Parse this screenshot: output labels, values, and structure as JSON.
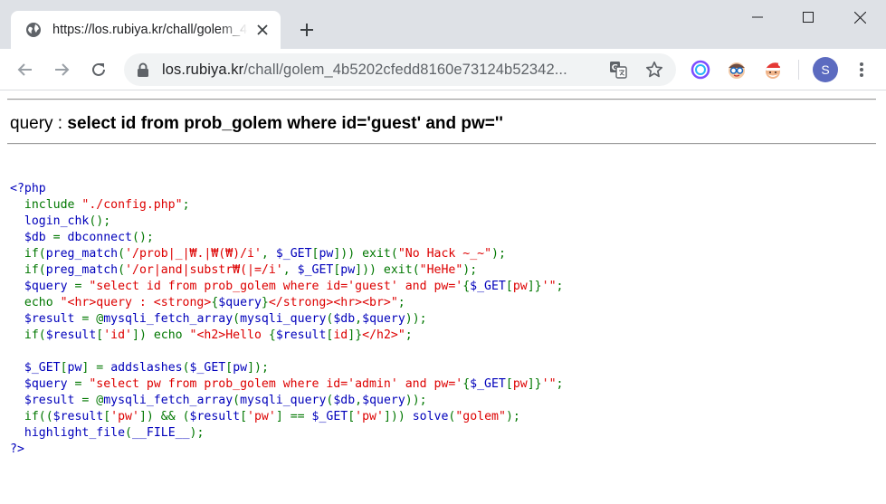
{
  "browser": {
    "tab": {
      "title": "https://los.rubiya.kr/chall/golem_4b5202cfedd8160e73124b52342..."
    },
    "address_bar": {
      "host": "los.rubiya.kr",
      "path": "/chall/golem_4b5202cfedd8160e73124b52342..."
    },
    "profile_initial": "S",
    "icons": {
      "tab_favicon": "globe-icon",
      "tab_close": "close-icon",
      "new_tab": "plus-icon",
      "minimize": "minimize-icon",
      "maximize": "maximize-icon",
      "close_window": "close-icon",
      "back": "arrow-left-icon",
      "forward": "arrow-right-icon",
      "reload": "reload-icon",
      "secure": "lock-icon",
      "translate": "translate-icon",
      "bookmark": "star-icon",
      "extensions": [
        "ring-extension-icon",
        "glasses-face-extension-icon",
        "santa-extension-icon"
      ],
      "menu": "three-dots-icon"
    },
    "colors": {
      "tabstrip": "#dee1e6",
      "omnibox": "#f1f3f4",
      "avatar": "#5c6bc0"
    }
  },
  "page": {
    "query_label": "query : ",
    "query_value": "select id from prob_golem where id='guest' and pw=''",
    "code_lines": [
      [
        {
          "t": "<?php",
          "c": "def"
        }
      ],
      [
        {
          "t": "  include ",
          "c": "kw"
        },
        {
          "t": "\"./config.php\"",
          "c": "str"
        },
        {
          "t": ";",
          "c": "kw"
        }
      ],
      [
        {
          "t": "  login_chk",
          "c": "def"
        },
        {
          "t": "();",
          "c": "kw"
        }
      ],
      [
        {
          "t": "  $db ",
          "c": "def"
        },
        {
          "t": "= ",
          "c": "kw"
        },
        {
          "t": "dbconnect",
          "c": "def"
        },
        {
          "t": "();",
          "c": "kw"
        }
      ],
      [
        {
          "t": "  if(",
          "c": "kw"
        },
        {
          "t": "preg_match",
          "c": "def"
        },
        {
          "t": "(",
          "c": "kw"
        },
        {
          "t": "'/prob|_|₩.|₩(₩)/i'",
          "c": "str"
        },
        {
          "t": ", ",
          "c": "kw"
        },
        {
          "t": "$_GET",
          "c": "def"
        },
        {
          "t": "[",
          "c": "kw"
        },
        {
          "t": "pw",
          "c": "def"
        },
        {
          "t": "])) exit(",
          "c": "kw"
        },
        {
          "t": "\"No Hack ~_~\"",
          "c": "str"
        },
        {
          "t": ");",
          "c": "kw"
        }
      ],
      [
        {
          "t": "  if(",
          "c": "kw"
        },
        {
          "t": "preg_match",
          "c": "def"
        },
        {
          "t": "(",
          "c": "kw"
        },
        {
          "t": "'/or|and|substr₩(|=/i'",
          "c": "str"
        },
        {
          "t": ", ",
          "c": "kw"
        },
        {
          "t": "$_GET",
          "c": "def"
        },
        {
          "t": "[",
          "c": "kw"
        },
        {
          "t": "pw",
          "c": "def"
        },
        {
          "t": "])) exit(",
          "c": "kw"
        },
        {
          "t": "\"HeHe\"",
          "c": "str"
        },
        {
          "t": ");",
          "c": "kw"
        }
      ],
      [
        {
          "t": "  $query ",
          "c": "def"
        },
        {
          "t": "= ",
          "c": "kw"
        },
        {
          "t": "\"select id from prob_golem where id='guest' and pw='",
          "c": "str"
        },
        {
          "t": "{",
          "c": "kw"
        },
        {
          "t": "$_GET",
          "c": "def"
        },
        {
          "t": "[",
          "c": "kw"
        },
        {
          "t": "pw",
          "c": "str"
        },
        {
          "t": "]",
          "c": "kw"
        },
        {
          "t": "}",
          "c": "kw"
        },
        {
          "t": "'\"",
          "c": "str"
        },
        {
          "t": ";",
          "c": "kw"
        }
      ],
      [
        {
          "t": "  echo ",
          "c": "kw"
        },
        {
          "t": "\"<hr>query : <strong>",
          "c": "str"
        },
        {
          "t": "{",
          "c": "kw"
        },
        {
          "t": "$query",
          "c": "def"
        },
        {
          "t": "}",
          "c": "kw"
        },
        {
          "t": "</strong><hr><br>\"",
          "c": "str"
        },
        {
          "t": ";",
          "c": "kw"
        }
      ],
      [
        {
          "t": "  $result ",
          "c": "def"
        },
        {
          "t": "= @",
          "c": "kw"
        },
        {
          "t": "mysqli_fetch_array",
          "c": "def"
        },
        {
          "t": "(",
          "c": "kw"
        },
        {
          "t": "mysqli_query",
          "c": "def"
        },
        {
          "t": "(",
          "c": "kw"
        },
        {
          "t": "$db",
          "c": "def"
        },
        {
          "t": ",",
          "c": "kw"
        },
        {
          "t": "$query",
          "c": "def"
        },
        {
          "t": "));",
          "c": "kw"
        }
      ],
      [
        {
          "t": "  if(",
          "c": "kw"
        },
        {
          "t": "$result",
          "c": "def"
        },
        {
          "t": "[",
          "c": "kw"
        },
        {
          "t": "'id'",
          "c": "str"
        },
        {
          "t": "]) echo ",
          "c": "kw"
        },
        {
          "t": "\"<h2>Hello ",
          "c": "str"
        },
        {
          "t": "{",
          "c": "kw"
        },
        {
          "t": "$result",
          "c": "def"
        },
        {
          "t": "[",
          "c": "kw"
        },
        {
          "t": "id",
          "c": "str"
        },
        {
          "t": "]",
          "c": "kw"
        },
        {
          "t": "}",
          "c": "kw"
        },
        {
          "t": "</h2>\"",
          "c": "str"
        },
        {
          "t": ";",
          "c": "kw"
        }
      ],
      [
        {
          "t": "",
          "c": "kw"
        }
      ],
      [
        {
          "t": "  $_GET",
          "c": "def"
        },
        {
          "t": "[",
          "c": "kw"
        },
        {
          "t": "pw",
          "c": "def"
        },
        {
          "t": "] = ",
          "c": "kw"
        },
        {
          "t": "addslashes",
          "c": "def"
        },
        {
          "t": "(",
          "c": "kw"
        },
        {
          "t": "$_GET",
          "c": "def"
        },
        {
          "t": "[",
          "c": "kw"
        },
        {
          "t": "pw",
          "c": "def"
        },
        {
          "t": "]);",
          "c": "kw"
        }
      ],
      [
        {
          "t": "  $query ",
          "c": "def"
        },
        {
          "t": "= ",
          "c": "kw"
        },
        {
          "t": "\"select pw from prob_golem where id='admin' and pw='",
          "c": "str"
        },
        {
          "t": "{",
          "c": "kw"
        },
        {
          "t": "$_GET",
          "c": "def"
        },
        {
          "t": "[",
          "c": "kw"
        },
        {
          "t": "pw",
          "c": "str"
        },
        {
          "t": "]",
          "c": "kw"
        },
        {
          "t": "}",
          "c": "kw"
        },
        {
          "t": "'\"",
          "c": "str"
        },
        {
          "t": ";",
          "c": "kw"
        }
      ],
      [
        {
          "t": "  $result ",
          "c": "def"
        },
        {
          "t": "= @",
          "c": "kw"
        },
        {
          "t": "mysqli_fetch_array",
          "c": "def"
        },
        {
          "t": "(",
          "c": "kw"
        },
        {
          "t": "mysqli_query",
          "c": "def"
        },
        {
          "t": "(",
          "c": "kw"
        },
        {
          "t": "$db",
          "c": "def"
        },
        {
          "t": ",",
          "c": "kw"
        },
        {
          "t": "$query",
          "c": "def"
        },
        {
          "t": "));",
          "c": "kw"
        }
      ],
      [
        {
          "t": "  if((",
          "c": "kw"
        },
        {
          "t": "$result",
          "c": "def"
        },
        {
          "t": "[",
          "c": "kw"
        },
        {
          "t": "'pw'",
          "c": "str"
        },
        {
          "t": "]) && (",
          "c": "kw"
        },
        {
          "t": "$result",
          "c": "def"
        },
        {
          "t": "[",
          "c": "kw"
        },
        {
          "t": "'pw'",
          "c": "str"
        },
        {
          "t": "] == ",
          "c": "kw"
        },
        {
          "t": "$_GET",
          "c": "def"
        },
        {
          "t": "[",
          "c": "kw"
        },
        {
          "t": "'pw'",
          "c": "str"
        },
        {
          "t": "])) ",
          "c": "kw"
        },
        {
          "t": "solve",
          "c": "def"
        },
        {
          "t": "(",
          "c": "kw"
        },
        {
          "t": "\"golem\"",
          "c": "str"
        },
        {
          "t": ");",
          "c": "kw"
        }
      ],
      [
        {
          "t": "  highlight_file",
          "c": "def"
        },
        {
          "t": "(",
          "c": "kw"
        },
        {
          "t": "__FILE__",
          "c": "def"
        },
        {
          "t": ");",
          "c": "kw"
        }
      ],
      [
        {
          "t": "?>",
          "c": "def"
        }
      ]
    ],
    "syntax_colors": {
      "default": "#0000bb",
      "keyword": "#007700",
      "string": "#dd0000"
    }
  }
}
